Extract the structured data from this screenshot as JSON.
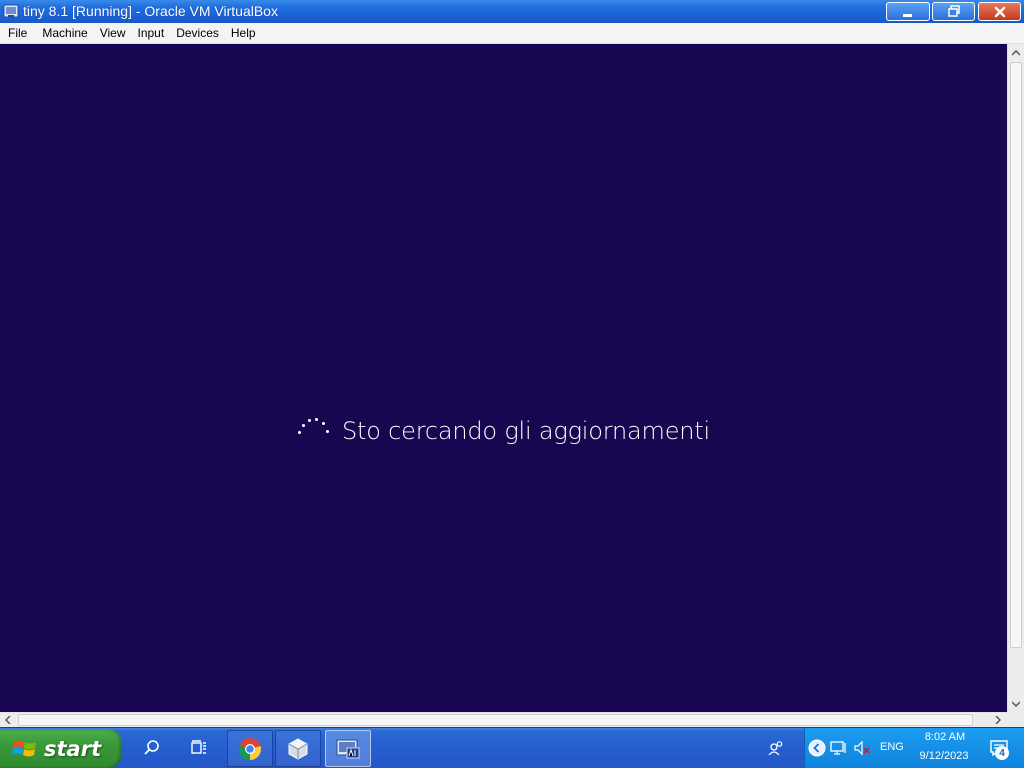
{
  "window": {
    "title": "tiny 8.1 [Running] - Oracle VM VirtualBox",
    "app_icon": "virtualbox-icon",
    "controls": [
      "minimize-icon",
      "maximize-icon",
      "close-icon"
    ]
  },
  "menubar": {
    "items": [
      {
        "label": "File"
      },
      {
        "label": "Machine"
      },
      {
        "label": "View"
      },
      {
        "label": "Input"
      },
      {
        "label": "Devices"
      },
      {
        "label": "Help"
      }
    ]
  },
  "vm_screen": {
    "background": "#190650",
    "status_text": "Sto cercando gli aggiornamenti",
    "spinner_icon": "loading-spinner-icon"
  },
  "taskbar": {
    "start_label": "start",
    "pinned": [
      {
        "name": "search-icon"
      },
      {
        "name": "task-view-icon"
      },
      {
        "name": "chrome-icon"
      },
      {
        "name": "virtualbox-icon"
      },
      {
        "name": "vm-window-icon"
      }
    ],
    "tray": {
      "language": "ENG",
      "time": "8:02 AM",
      "date": "9/12/2023",
      "notification_count": "4"
    }
  },
  "colors": {
    "titlebar": "#1f6fe0",
    "menubar": "#f4f4f4",
    "vm_background": "#190650",
    "taskbar": "#255ed0",
    "start_button": "#3a9a3a",
    "tray": "#1690e6"
  }
}
